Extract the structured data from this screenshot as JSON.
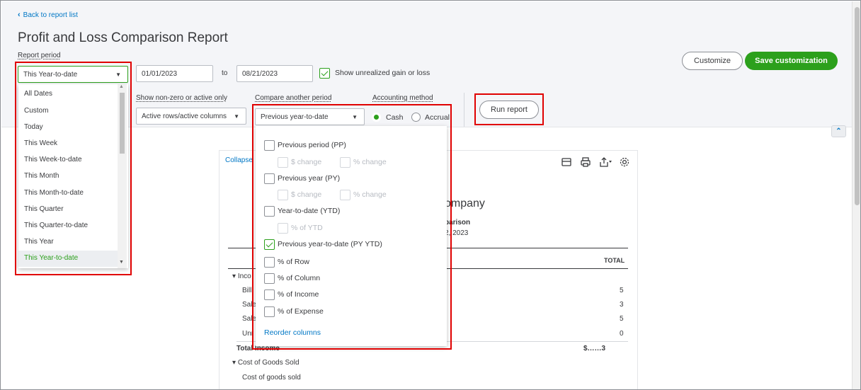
{
  "header": {
    "back_link": "Back to report list",
    "title": "Profit and Loss Comparison Report"
  },
  "report_period": {
    "label": "Report period",
    "selected": "This Year-to-date",
    "from_date": "01/01/2023",
    "to_text": "to",
    "to_date": "08/21/2023",
    "show_unrealized": "Show unrealized gain or loss",
    "options": [
      "All Dates",
      "Custom",
      "Today",
      "This Week",
      "This Week-to-date",
      "This Month",
      "This Month-to-date",
      "This Quarter",
      "This Quarter-to-date",
      "This Year",
      "This Year-to-date"
    ]
  },
  "filters": {
    "nonzero_label": "Show non-zero or active only",
    "nonzero_value": "Active rows/active columns",
    "compare_label": "Compare another period",
    "compare_value": "Previous year-to-date",
    "accounting_label": "Accounting method",
    "cash": "Cash",
    "accrual": "Accrual",
    "run_report": "Run report"
  },
  "actions": {
    "customize": "Customize",
    "save": "Save customization"
  },
  "compare_options": {
    "pp": "Previous period (PP)",
    "pp_dollar": "$ change",
    "pp_pct": "% change",
    "py": "Previous year (PY)",
    "py_dollar": "$ change",
    "py_pct": "% change",
    "ytd": "Year-to-date (YTD)",
    "ytd_pct": "% of YTD",
    "pytd": "Previous year-to-date (PY YTD)",
    "pct_row": "% of Row",
    "pct_col": "% of Column",
    "pct_income": "% of Income",
    "pct_expense": "% of Expense",
    "reorder": "Reorder columns"
  },
  "report": {
    "collapse": "Collapse",
    "company": "ompany",
    "subtitle": "parison",
    "date": "2, 2023",
    "total_header": "TOTAL",
    "income_section": "Inco",
    "rows": [
      "Bill",
      "Sale",
      "Sale",
      "Unr"
    ],
    "row_values": [
      "5",
      "3",
      "5",
      "0"
    ],
    "total_income": "Total Income",
    "total_income_value": "$……3",
    "cogs_section": "Cost of Goods Sold",
    "cogs_row": "Cost of goods sold"
  },
  "colors": {
    "accent_green": "#2ca01c",
    "link_blue": "#0077c5",
    "highlight_red": "#e00000"
  }
}
